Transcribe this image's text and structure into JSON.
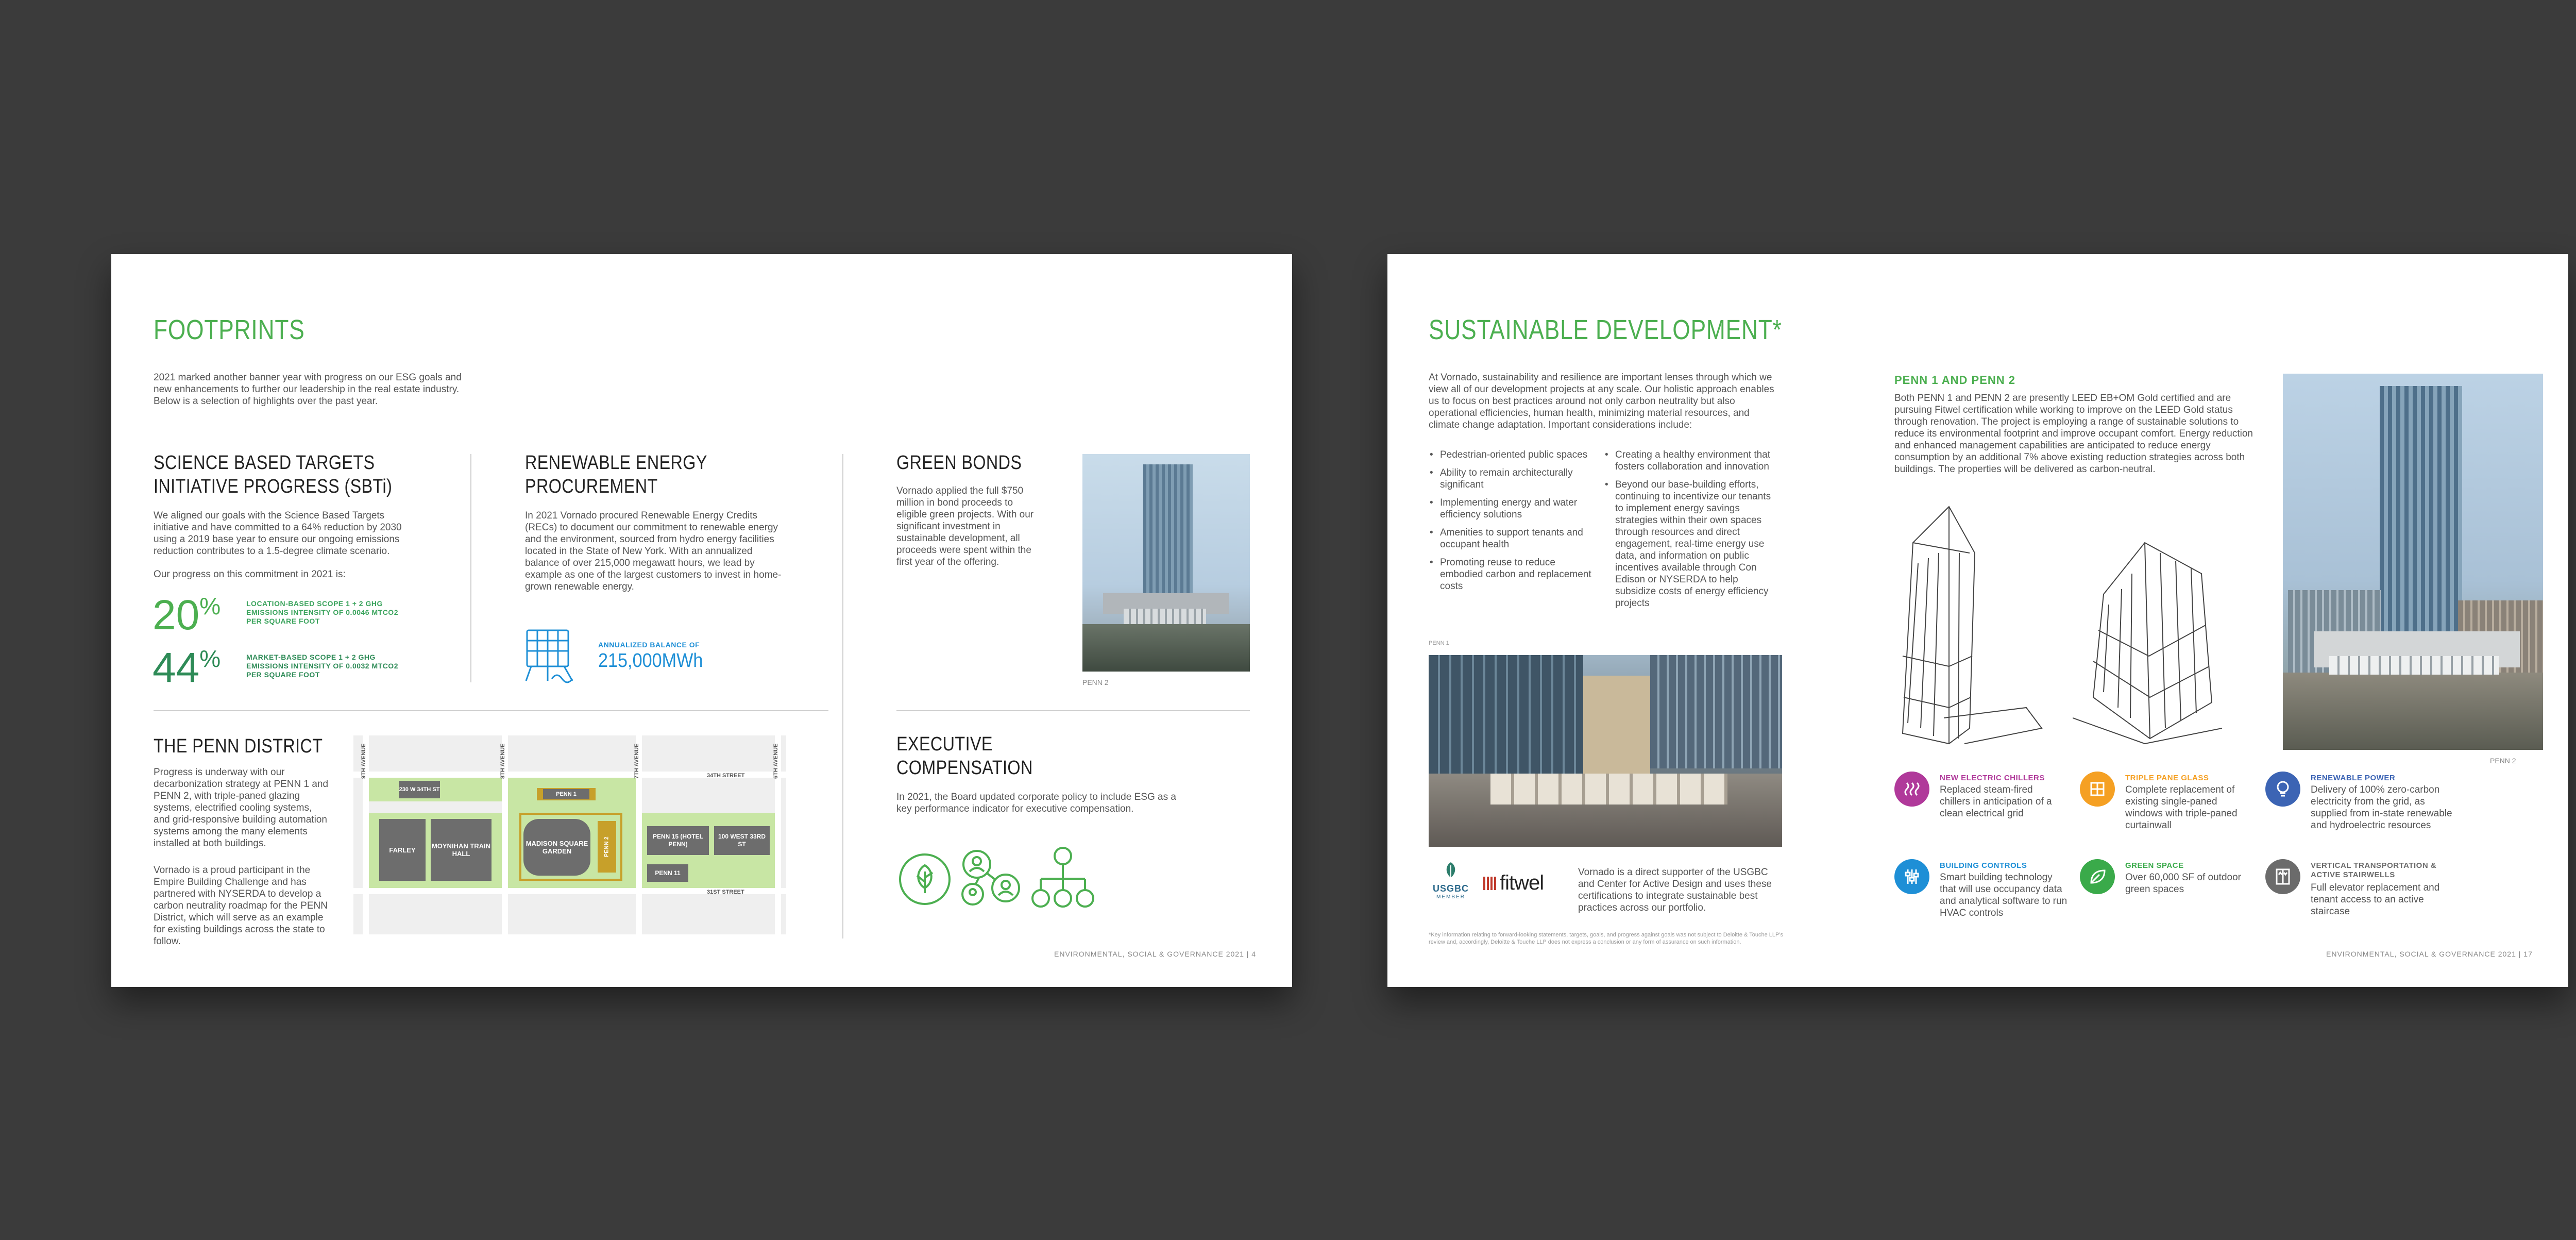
{
  "left_page": {
    "title": "FOOTPRINTS",
    "intro": "2021 marked another banner year with progress on our ESG goals and new enhancements to further our leadership in the real estate industry. Below is a selection of highlights over the past year.",
    "sbti": {
      "heading": "SCIENCE BASED TARGETS INITIATIVE PROGRESS (SBTi)",
      "body": "We aligned our goals with the Science Based Targets initiative and have committed to a 64% reduction by 2030 using a 2019 base year to ensure our ongoing emissions reduction contributes to a 1.5-degree climate scenario.",
      "progress_label": "Our progress on this commitment in 2021 is:",
      "stat1_number": "20",
      "stat1_unit": "%",
      "stat1_label": "LOCATION-BASED SCOPE 1 + 2 GHG EMISSIONS INTENSITY OF 0.0046 MTCO2 PER SQUARE FOOT",
      "stat2_number": "44",
      "stat2_unit": "%",
      "stat2_label": "MARKET-BASED SCOPE 1 + 2 GHG EMISSIONS INTENSITY OF 0.0032 MTCO2 PER SQUARE FOOT"
    },
    "renewable": {
      "heading": "RENEWABLE ENERGY PROCUREMENT",
      "body": "In 2021 Vornado procured Renewable Energy Credits (RECs) to document our commitment to renewable energy and the environment, sourced from hydro energy facilities located in the State of New York. With an annualized balance of over 215,000 megawatt hours, we lead by example as one of the largest customers to invest in home-grown renewable energy.",
      "balance_label": "ANNUALIZED BALANCE OF",
      "balance_value": "215,000MWh"
    },
    "green_bonds": {
      "heading": "GREEN BONDS",
      "body": "Vornado applied the full $750 million in bond proceeds to eligible green projects. With our significant investment in sustainable development, all proceeds were spent within the first year of the offering.",
      "caption": "PENN 2"
    },
    "penn_district": {
      "heading": "THE PENN DISTRICT",
      "body1": "Progress is underway with our decarbonization strategy at PENN 1 and PENN 2, with triple-paned glazing systems, electrified cooling systems, and grid-responsive building automation systems among the many elements installed at both buildings.",
      "body2": "Vornado is a proud participant in the Empire Building Challenge and has partnered with NYSERDA to develop a carbon neutrality roadmap for the PENN District, which will serve as an example for existing buildings across the state to follow.",
      "map": {
        "street_34": "34TH STREET",
        "street_31": "31ST STREET",
        "ave_9": "9TH AVENUE",
        "ave_8": "8TH AVENUE",
        "ave_7": "7TH AVENUE",
        "ave_6": "6TH AVENUE",
        "b_230w": "230 W 34TH ST",
        "b_penn1": "PENN 1",
        "b_farley": "FARLEY",
        "b_moynihan": "MOYNIHAN TRAIN HALL",
        "b_msg": "MADISON SQUARE GARDEN",
        "b_penn2": "PENN 2",
        "b_penn15": "PENN 15 (HOTEL PENN)",
        "b_100w": "100 WEST 33RD ST",
        "b_penn11": "PENN 11"
      }
    },
    "exec_comp": {
      "heading": "EXECUTIVE COMPENSATION",
      "body": "In 2021, the Board updated corporate policy to include ESG as a key performance indicator for executive compensation."
    },
    "footer": "ENVIRONMENTAL, SOCIAL & GOVERNANCE 2021 | 4"
  },
  "right_page": {
    "title": "SUSTAINABLE DEVELOPMENT*",
    "intro": "At Vornado, sustainability and resilience are important lenses through which we view all of our development projects at any scale. Our holistic approach enables us to focus on best practices around not only carbon neutrality but also operational efficiencies, human health, minimizing material resources, and climate change adaptation. Important considerations include:",
    "bullets_left": [
      "Pedestrian-oriented public spaces",
      "Ability to remain architecturally significant",
      "Implementing energy and water efficiency solutions",
      "Amenities to support tenants and occupant health",
      "Promoting reuse to reduce embodied carbon and replacement costs"
    ],
    "bullets_right": [
      "Creating a healthy environment that fosters collaboration and innovation",
      "Beyond our base-building efforts, continuing to incentivize our tenants to implement energy savings strategies within their own spaces through resources and direct engagement, real-time energy use data, and information on public incentives available through Con Edison or NYSERDA to help subsidize costs of energy efficiency projects"
    ],
    "photo_caption": "PENN 1",
    "usgbc": "USGBC",
    "usgbc_member": "MEMBER",
    "fitwel": "fitwel",
    "supporter_text": "Vornado is a direct supporter of the USGBC and Center for Active Design and uses these certifications to integrate sustainable best practices across our portfolio.",
    "disclaimer": "*Key information relating to forward-looking statements, targets, goals, and progress against goals was not subject to Deloitte & Touche LLP's review and, accordingly, Deloitte & Touche LLP does not express a conclusion or any form of assurance on such information.",
    "penn_heading": "PENN 1 AND PENN 2",
    "penn_body": "Both PENN 1 and PENN 2 are presently LEED EB+OM Gold certified and are pursuing Fitwel certification while working to improve on the LEED Gold status through renovation. The project is employing a range of sustainable solutions to reduce its environmental footprint and improve occupant comfort. Energy reduction and enhanced management capabilities are anticipated to reduce energy consumption by an additional 7% above existing reduction strategies across both buildings. The properties will be delivered as carbon-neutral.",
    "render_caption": "PENN 2",
    "features": [
      {
        "title": "NEW ELECTRIC CHILLERS",
        "body": "Replaced steam-fired chillers in anticipation of a clean electrical grid",
        "color": "#b0399a"
      },
      {
        "title": "TRIPLE PANE GLASS",
        "body": "Complete replacement of existing single-paned windows with triple-paned curtainwall",
        "color": "#f5a023"
      },
      {
        "title": "RENEWABLE POWER",
        "body": "Delivery of 100% zero-carbon electricity from the grid, as supplied from in-state renewable and hydroelectric resources",
        "color": "#3c64b4"
      },
      {
        "title": "BUILDING CONTROLS",
        "body": "Smart building technology that will use occupancy data and analytical software to run HVAC controls",
        "color": "#1e8fd6"
      },
      {
        "title": "GREEN SPACE",
        "body": "Over 60,000 SF of outdoor green spaces",
        "color": "#3aaa4a"
      },
      {
        "title": "VERTICAL TRANSPORTATION & ACTIVE STAIRWELLS",
        "body": "Full elevator replacement and tenant access to an active staircase",
        "color": "#6b6b6b"
      }
    ],
    "footer": "ENVIRONMENTAL, SOCIAL & GOVERNANCE 2021 | 17"
  },
  "colors": {
    "accent_green": "#4caf50",
    "dark_green": "#2e8b57",
    "background": "#3b3b3b"
  }
}
